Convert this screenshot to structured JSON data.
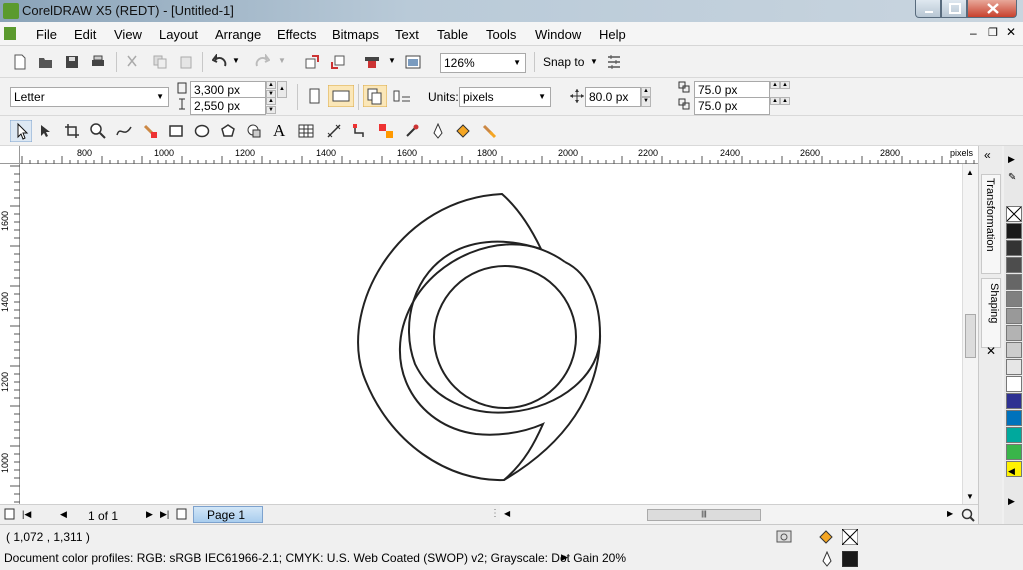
{
  "window": {
    "title": "CorelDRAW X5 (REDT) - [Untitled-1]"
  },
  "menu": [
    "File",
    "Edit",
    "View",
    "Layout",
    "Arrange",
    "Effects",
    "Bitmaps",
    "Text",
    "Table",
    "Tools",
    "Window",
    "Help"
  ],
  "standard_toolbar": {
    "zoom": "126%",
    "snap_to": "Snap to"
  },
  "property_bar": {
    "page_size": "Letter",
    "width": "3,300 px",
    "height": "2,550 px",
    "units_label": "Units:",
    "units": "pixels",
    "nudge": "80.0 px",
    "dup_x": "75.0 px",
    "dup_y": "75.0 px"
  },
  "ruler": {
    "h_labels": [
      "800",
      "1000",
      "1200",
      "1400",
      "1600",
      "1800",
      "2000",
      "2200",
      "2400",
      "2600",
      "2800"
    ],
    "unit": "pixels",
    "v_labels": [
      "1600",
      "1400",
      "1200",
      "1000"
    ]
  },
  "dockers": {
    "transformation": "Transformation",
    "shaping": "Shaping"
  },
  "pages": {
    "counter": "1 of 1",
    "tab": "Page 1"
  },
  "status": {
    "coords": "( 1,072 , 1,311 )",
    "profiles": "Document color profiles: RGB: sRGB IEC61966-2.1; CMYK: U.S. Web Coated (SWOP) v2; Grayscale: Dot Gain 20%"
  },
  "palette_colors": [
    "#ffffff",
    "#1a1a1a",
    "#333333",
    "#4d4d4d",
    "#666666",
    "#808080",
    "#999999",
    "#b3b3b3",
    "#cccccc",
    "#e6e6e6",
    "#ffffff",
    "#2e3192",
    "#0072bc",
    "#00a99d",
    "#39b54a",
    "#fff200"
  ],
  "icons": {
    "pick": "pick-tool-icon",
    "shape": "shape-tool-icon",
    "zoom": "zoom-tool-icon"
  }
}
